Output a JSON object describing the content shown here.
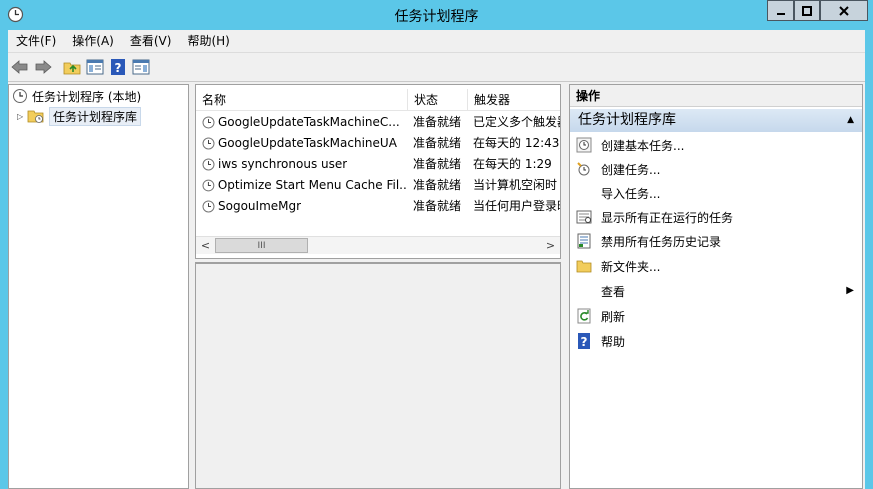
{
  "window": {
    "title": "任务计划程序"
  },
  "menu": {
    "items": [
      "文件(F)",
      "操作(A)",
      "查看(V)",
      "帮助(H)"
    ]
  },
  "toolbar": {
    "buttons": [
      "back-arrow-icon",
      "forward-arrow-icon",
      "up-folder-icon",
      "show-hide-tree-icon",
      "help-icon",
      "show-hide-action-pane-icon"
    ]
  },
  "tree": {
    "root": "任务计划程序 (本地)",
    "child": "任务计划程序库"
  },
  "list": {
    "columns": [
      "名称",
      "状态",
      "触发器"
    ],
    "rows": [
      {
        "name": "GoogleUpdateTaskMachineC...",
        "status": "准备就绪",
        "trigger": "已定义多个触发器"
      },
      {
        "name": "GoogleUpdateTaskMachineUA",
        "status": "准备就绪",
        "trigger": "在每天的 12:43"
      },
      {
        "name": "iws synchronous user",
        "status": "准备就绪",
        "trigger": "在每天的 1:29"
      },
      {
        "name": "Optimize Start Menu Cache Fil...",
        "status": "准备就绪",
        "trigger": "当计算机空闲时"
      },
      {
        "name": "SogouImeMgr",
        "status": "准备就绪",
        "trigger": "当任何用户登录时"
      }
    ],
    "scroll_thumb_glyph": "III"
  },
  "actions": {
    "header": "操作",
    "section": "任务计划程序库",
    "items": [
      {
        "label": "创建基本任务...",
        "icon": "create-basic-task-icon"
      },
      {
        "label": "创建任务...",
        "icon": "create-task-icon"
      },
      {
        "label": "导入任务...",
        "icon": ""
      },
      {
        "label": "显示所有正在运行的任务",
        "icon": "running-tasks-icon"
      },
      {
        "label": "禁用所有任务历史记录",
        "icon": "history-icon"
      },
      {
        "label": "新文件夹...",
        "icon": "new-folder-icon"
      },
      {
        "label": "查看",
        "icon": ""
      },
      {
        "label": "刷新",
        "icon": "refresh-icon"
      },
      {
        "label": "帮助",
        "icon": "help-icon"
      }
    ]
  }
}
